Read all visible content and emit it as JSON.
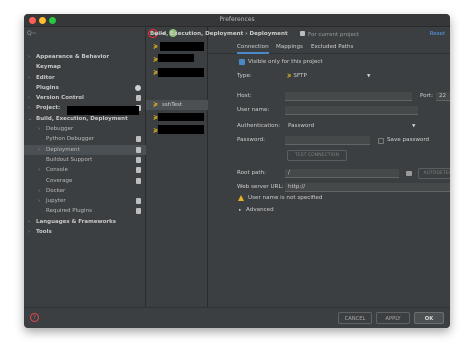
{
  "window": {
    "title": "Preferences"
  },
  "sidebar": {
    "search_placeholder": "Q~",
    "items": [
      {
        "label": "Appearance & Behavior",
        "arrow": "›",
        "bold": true
      },
      {
        "label": "Keymap",
        "bold": true
      },
      {
        "label": "Editor",
        "arrow": "›",
        "bold": true
      },
      {
        "label": "Plugins",
        "bold": true,
        "badge": true
      },
      {
        "label": "Version Control",
        "arrow": "›",
        "bold": true,
        "icon": true
      },
      {
        "label": "Project:",
        "arrow": "›",
        "bold": true,
        "icon": true
      },
      {
        "label": "Build, Execution, Deployment",
        "arrow": "⌄",
        "bold": true
      },
      {
        "label": "Debugger",
        "arrow": "›"
      },
      {
        "label": "Python Debugger",
        "icon": true
      },
      {
        "label": "Deployment",
        "arrow": "›",
        "selected": true,
        "icon": true
      },
      {
        "label": "Buildout Support",
        "icon": true
      },
      {
        "label": "Console",
        "arrow": "›",
        "icon": true
      },
      {
        "label": "Coverage",
        "icon": true
      },
      {
        "label": "Docker",
        "arrow": "›"
      },
      {
        "label": "Jupyter",
        "arrow": "›",
        "icon": true
      },
      {
        "label": "Required Plugins",
        "icon": true
      },
      {
        "label": "Languages & Frameworks",
        "arrow": "›",
        "bold": true
      },
      {
        "label": "Tools",
        "arrow": "›",
        "bold": true
      }
    ]
  },
  "servers": {
    "items": [
      {
        "label": "",
        "selected": false
      },
      {
        "label": "",
        "selected": false
      },
      {
        "label": "",
        "selected": false
      },
      {
        "label": "sshTest",
        "selected": true
      },
      {
        "label": "",
        "selected": false
      },
      {
        "label": "",
        "selected": false
      }
    ]
  },
  "content": {
    "breadcrumb": "Build, Execution, Deployment  ›  Deployment",
    "project_scope": "For current project",
    "reset": "Reset",
    "tabs": [
      "Connection",
      "Mappings",
      "Excluded Paths"
    ],
    "visible_only": "Visible only for this project",
    "type_label": "Type:",
    "type_value": "SFTP",
    "host_label": "Host:",
    "host_value": "",
    "port_label": "Port:",
    "port_value": "22",
    "user_label": "User name:",
    "user_value": "",
    "auth_label": "Authentication:",
    "auth_value": "Password",
    "password_label": "Password:",
    "password_value": "",
    "save_password": "Save password",
    "test_connection": "TEST CONNECTION",
    "root_label": "Root path:",
    "root_value": "/",
    "autodetect": "AUTODETECT",
    "weburl_label": "Web server URL:",
    "weburl_value": "http://",
    "warning": "User name is not specified",
    "advanced": "Advanced"
  },
  "buttons": {
    "help": "?",
    "cancel": "CANCEL",
    "apply": "APPLY",
    "ok": "OK"
  }
}
